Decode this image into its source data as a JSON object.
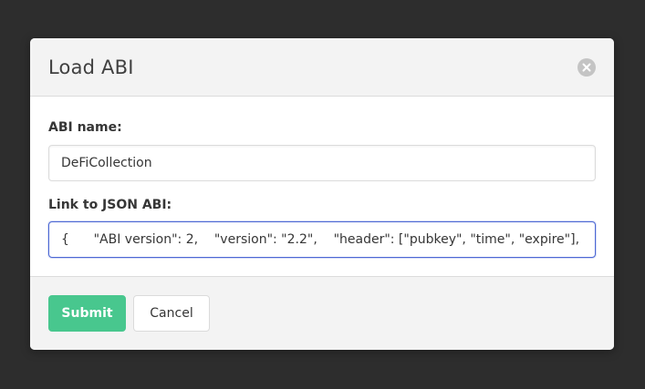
{
  "modal": {
    "title": "Load ABI",
    "close_icon": "close-icon"
  },
  "form": {
    "name_label": "ABI name:",
    "name_value": "DeFiCollection",
    "json_label": "Link to JSON ABI:",
    "json_value": "{      \"ABI version\": 2,    \"version\": \"2.2\",    \"header\": [\"pubkey\", \"time\", \"expire\"],"
  },
  "footer": {
    "submit_label": "Submit",
    "cancel_label": "Cancel"
  },
  "colors": {
    "backdrop": "#2d2d2d",
    "submit": "#48c78e",
    "focus_border": "#4d68d4"
  }
}
